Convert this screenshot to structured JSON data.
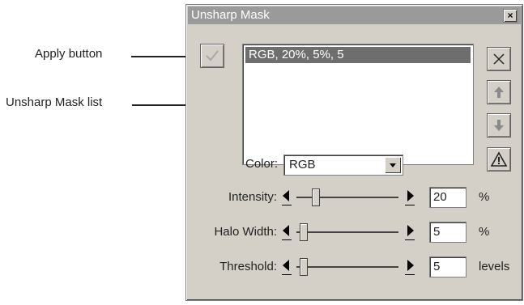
{
  "callouts": {
    "apply": "Apply button",
    "list": "Unsharp Mask list"
  },
  "window": {
    "title": "Unsharp Mask",
    "close_glyph": "×"
  },
  "list": {
    "items": [
      "RGB, 20%, 5%, 5"
    ]
  },
  "color": {
    "label": "Color:",
    "value": "RGB"
  },
  "intensity": {
    "label": "Intensity:",
    "value": "20",
    "unit": "%",
    "level": 0.2
  },
  "halo": {
    "label": "Halo Width:",
    "value": "5",
    "unit": "%",
    "level": 0.05
  },
  "threshold": {
    "label": "Threshold:",
    "value": "5",
    "unit": "levels",
    "level": 0.05
  },
  "colors": {
    "selection": "#6e6e6e",
    "dialog": "#d4d0c8",
    "titlebar": "#9a9a9a"
  }
}
